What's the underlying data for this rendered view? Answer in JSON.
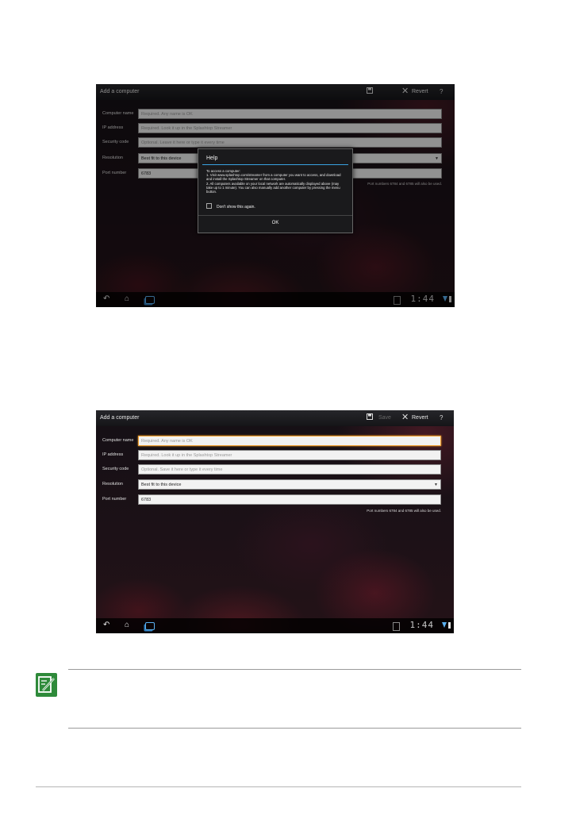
{
  "screenshot_top": {
    "actionbar": {
      "title": "Add a computer",
      "save_label": "Save",
      "revert_label": "Revert",
      "help_label": "?"
    },
    "form": [
      {
        "label": "Computer name",
        "placeholder": "Required. Any name is OK",
        "value": ""
      },
      {
        "label": "IP address",
        "placeholder": "Required. Look it up in the Splashtop Streamer",
        "value": ""
      },
      {
        "label": "Security code",
        "placeholder": "Optional. Leave it here or type it every time",
        "value": ""
      },
      {
        "label": "Resolution",
        "placeholder": "",
        "value": "Best fit to this device"
      },
      {
        "label": "Port number",
        "placeholder": "",
        "value": "6783"
      }
    ],
    "port_hint": "Port numbers 6784 and 6785 will also be used.",
    "dialog": {
      "title": "Help",
      "lines": [
        "To access a computer:",
        "1. Visit www.splashtop.com/streamer from a computer you want to access, and download and install the Splashtop Streamer on that computer.",
        "2. All computers available on your local network are automatically displayed above (may take up to 1 minute). You can also manually add another computer by pressing the menu button."
      ],
      "checkbox_label": "Don't show this again.",
      "ok_label": "OK"
    },
    "clock": "1:44"
  },
  "screenshot_bottom": {
    "actionbar": {
      "title": "Add a computer",
      "save_label": "Save",
      "revert_label": "Revert",
      "help_label": "?"
    },
    "form": [
      {
        "label": "Computer name",
        "placeholder": "Required. Any name is OK",
        "value": ""
      },
      {
        "label": "IP address",
        "placeholder": "Required. Look it up in the Splashtop Streamer",
        "value": ""
      },
      {
        "label": "Security code",
        "placeholder": "Optional. Save it here or type it every time",
        "value": ""
      },
      {
        "label": "Resolution",
        "placeholder": "",
        "value": "Best fit to this device"
      },
      {
        "label": "Port number",
        "placeholder": "",
        "value": "6783"
      }
    ],
    "port_hint": "Port numbers 6784 and 6785 will also be used.",
    "clock": "1:44"
  },
  "note_icon": "note-pencil-icon",
  "colors": {
    "note_green": "#2e8a3a",
    "accent_blue": "#39a2e0",
    "focus_orange": "#f0a030"
  }
}
